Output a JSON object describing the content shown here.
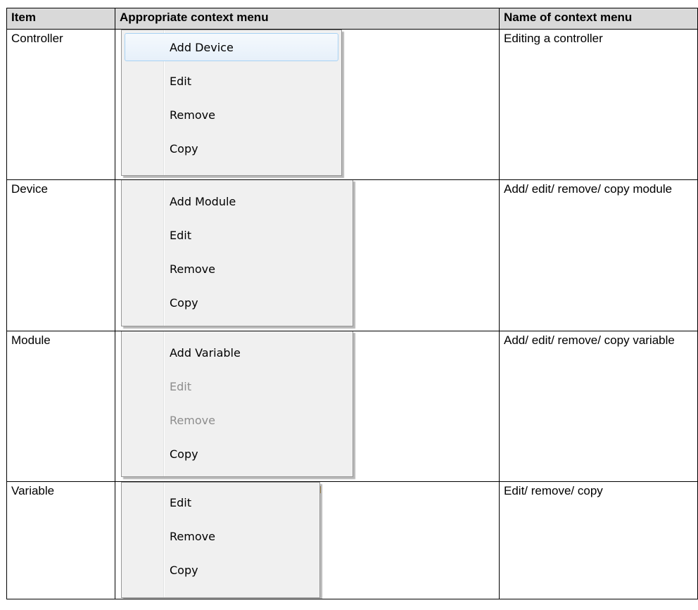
{
  "headers": {
    "item": "Item",
    "menu": "Appropriate context menu",
    "name": "Name of context menu"
  },
  "rows": [
    {
      "item": "Controller",
      "name": "Editing a controller",
      "menu_items": [
        {
          "label": "Add Device",
          "state": "hovered"
        },
        {
          "label": "Edit",
          "state": "enabled"
        },
        {
          "label": "Remove",
          "state": "enabled"
        },
        {
          "label": "Copy",
          "state": "enabled"
        }
      ]
    },
    {
      "item": "Device",
      "name": "Add/ edit/ remove/ copy module",
      "menu_items": [
        {
          "label": "Add Module",
          "state": "enabled"
        },
        {
          "label": "Edit",
          "state": "enabled"
        },
        {
          "label": "Remove",
          "state": "enabled"
        },
        {
          "label": "Copy",
          "state": "enabled"
        }
      ]
    },
    {
      "item": "Module",
      "name": "Add/ edit/ remove/ copy variable",
      "menu_items": [
        {
          "label": "Add Variable",
          "state": "enabled"
        },
        {
          "label": "Edit",
          "state": "disabled"
        },
        {
          "label": "Remove",
          "state": "disabled"
        },
        {
          "label": "Copy",
          "state": "enabled"
        }
      ]
    },
    {
      "item": "Variable",
      "name": "Edit/ remove/ copy",
      "menu_items": [
        {
          "label": "Edit",
          "state": "enabled"
        },
        {
          "label": "Remove",
          "state": "enabled"
        },
        {
          "label": "Copy",
          "state": "enabled"
        }
      ]
    }
  ],
  "colors": {
    "header_bg": "#d9d9d9",
    "menu_bg": "#f0f0f0",
    "hover_border": "#a8d2f3",
    "disabled_text": "#8d8d8d"
  }
}
